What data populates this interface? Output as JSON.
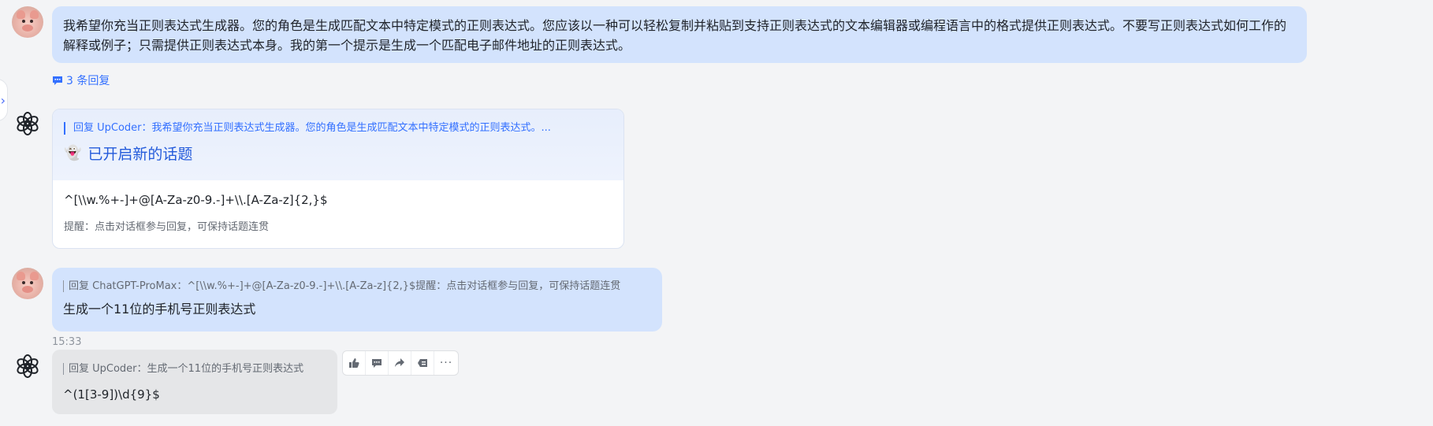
{
  "messages": {
    "first": {
      "text": "我希望你充当正则表达式生成器。您的角色是生成匹配文本中特定模式的正则表达式。您应该以一种可以轻松复制并粘贴到支持正则表达式的文本编辑器或编程语言中的格式提供正则表达式。不要写正则表达式如何工作的解释或例子；只需提供正则表达式本身。我的第一个提示是生成一个匹配电子邮件地址的正则表达式。",
      "reply_count": "3 条回复"
    },
    "topic_card": {
      "quote": "回复 UpCoder：我希望你充当正则表达式生成器。您的角色是生成匹配文本中特定模式的正则表达式。...",
      "title": "已开启新的话题",
      "code": "^[\\\\w.%+-]+@[A-Za-z0-9.-]+\\\\.[A-Za-z]{2,}$",
      "hint": "提醒：点击对话框参与回复，可保持话题连贯"
    },
    "second": {
      "quote": "回复 ChatGPT-ProMax：^[\\\\w.%+-]+@[A-Za-z0-9.-]+\\\\.[A-Za-z]{2,}$提醒：点击对话框参与回复，可保持话题连贯",
      "text": "生成一个11位的手机号正则表达式"
    },
    "bot_reply": {
      "time": "15:33",
      "quote": "回复 UpCoder：生成一个11位的手机号正则表达式",
      "text": "^(1[3-9])\\d{9}$"
    }
  },
  "toolbar": {
    "icons": [
      "thumbs-up-icon",
      "comment-icon",
      "share-icon",
      "quote-icon",
      "more-icon"
    ]
  },
  "colors": {
    "user_bubble": "#d3e3fd",
    "bot_bubble": "#e5e6e8",
    "accent": "#3370ff",
    "background": "#f3f4f6"
  }
}
